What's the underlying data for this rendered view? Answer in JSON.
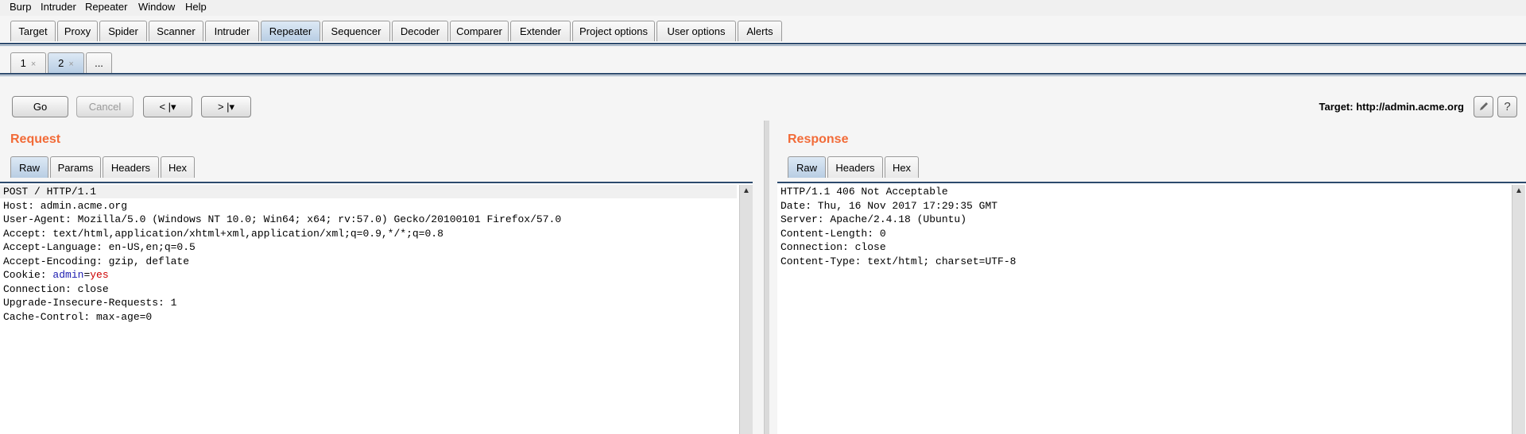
{
  "menubar": [
    "Burp",
    "Intruder",
    "Repeater",
    "Window",
    "Help"
  ],
  "main_tabs": [
    "Target",
    "Proxy",
    "Spider",
    "Scanner",
    "Intruder",
    "Repeater",
    "Sequencer",
    "Decoder",
    "Comparer",
    "Extender",
    "Project options",
    "User options",
    "Alerts"
  ],
  "active_main_tab": "Repeater",
  "repeater_tabs": [
    {
      "label": "1",
      "close": "×"
    },
    {
      "label": "2",
      "close": "×"
    },
    {
      "label": "..."
    }
  ],
  "toolbar": {
    "go": "Go",
    "cancel": "Cancel",
    "back": "< |▾",
    "forward": "> |▾",
    "target": "Target: http://admin.acme.org"
  },
  "icons": {
    "edit": "pencil-icon",
    "help": "help-icon"
  },
  "request": {
    "title": "Request",
    "tabs": [
      "Raw",
      "Params",
      "Headers",
      "Hex"
    ],
    "lines": [
      "POST / HTTP/1.1",
      "Host: admin.acme.org",
      "User-Agent: Mozilla/5.0 (Windows NT 10.0; Win64; x64; rv:57.0) Gecko/20100101 Firefox/57.0",
      "Accept: text/html,application/xhtml+xml,application/xml;q=0.9,*/*;q=0.8",
      "Accept-Language: en-US,en;q=0.5",
      "Accept-Encoding: gzip, deflate",
      "Connection: close",
      "Upgrade-Insecure-Requests: 1",
      "Cache-Control: max-age=0"
    ],
    "cookie": {
      "prefix": "Cookie: ",
      "name": "admin",
      "eq": "=",
      "value": "yes"
    }
  },
  "response": {
    "title": "Response",
    "tabs": [
      "Raw",
      "Headers",
      "Hex"
    ],
    "lines": [
      "HTTP/1.1 406 Not Acceptable",
      "Date: Thu, 16 Nov 2017 17:29:35 GMT",
      "Server: Apache/2.4.18 (Ubuntu)",
      "Content-Length: 0",
      "Connection: close",
      "Content-Type: text/html; charset=UTF-8"
    ]
  },
  "colors": {
    "accent": "#f26b38",
    "tab_active": "#b8cde3",
    "border_blue": "#2c4a6d"
  }
}
